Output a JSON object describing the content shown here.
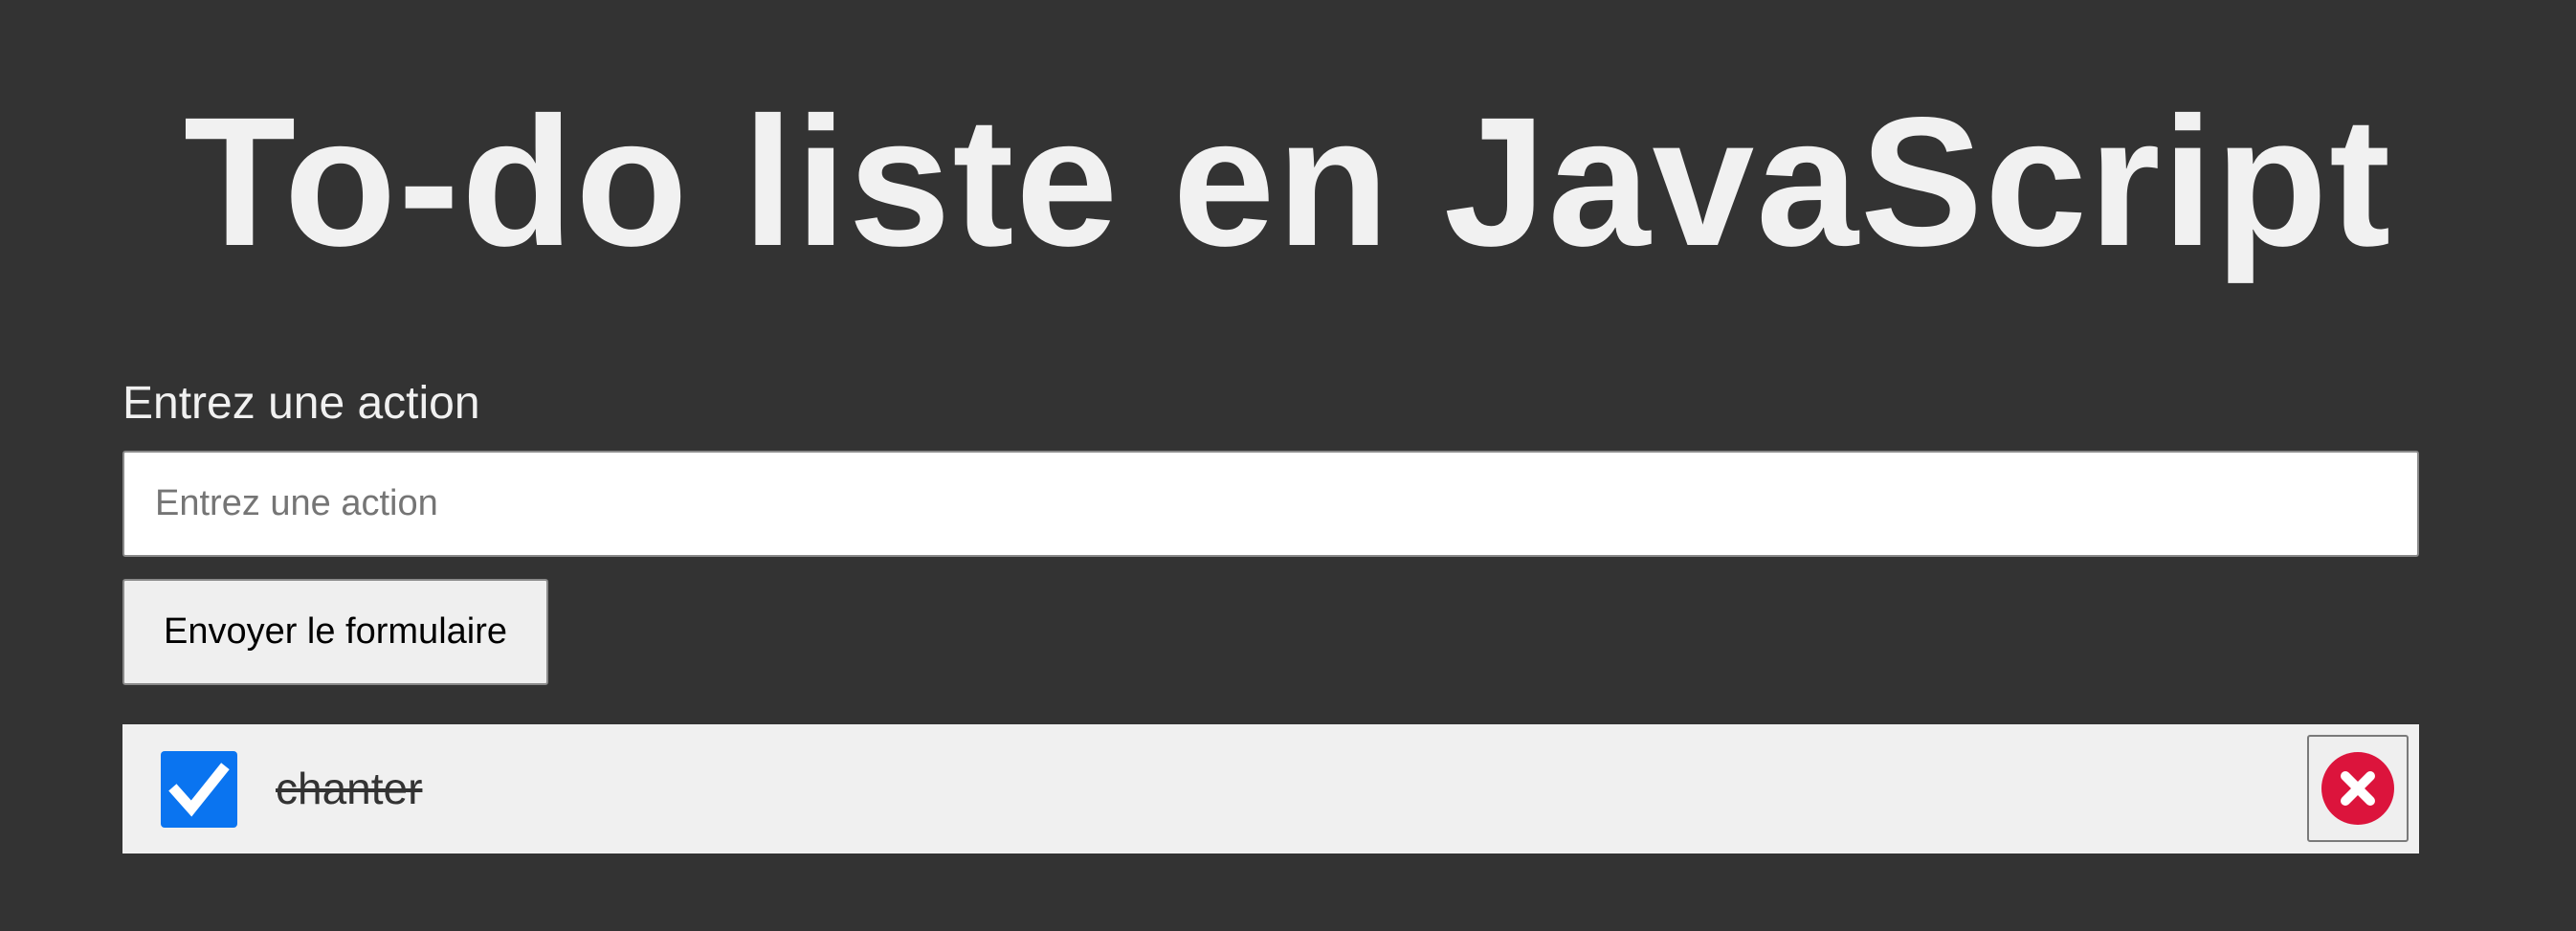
{
  "page": {
    "title": "To-do liste en JavaScript"
  },
  "form": {
    "label": "Entrez une action",
    "input_placeholder": "Entrez une action",
    "input_value": "",
    "submit_label": "Envoyer le formulaire"
  },
  "todos": [
    {
      "text": "chanter",
      "done": true,
      "icons": {
        "checkbox": "checkmark-icon",
        "delete": "close-circle-icon"
      }
    }
  ],
  "colors": {
    "background": "#333333",
    "title_text": "#f1f1f1",
    "checkbox_accent": "#0a74f0",
    "delete_icon": "#dc143c",
    "item_background": "#f0f0f0"
  }
}
